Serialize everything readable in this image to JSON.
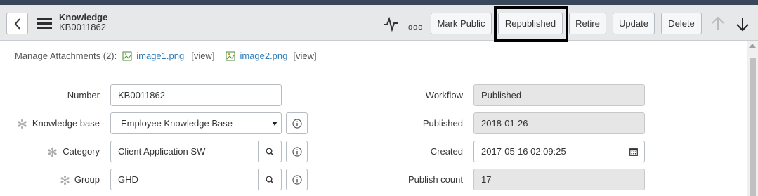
{
  "header": {
    "title": "Knowledge",
    "subtitle": "KB0011862",
    "buttons": {
      "mark_public": "Mark Public",
      "republished": "Republished",
      "retire": "Retire",
      "update": "Update",
      "delete": "Delete"
    },
    "more": "ooo"
  },
  "attachments": {
    "label": "Manage Attachments (2):",
    "files": [
      {
        "name": "image1.png",
        "view": "[view]"
      },
      {
        "name": "image2.png",
        "view": "[view]"
      }
    ]
  },
  "form": {
    "left": [
      {
        "label": "Number",
        "value": "KB0011862",
        "mandatory": false
      },
      {
        "label": "Knowledge base",
        "value": "Employee Knowledge Base",
        "mandatory": true
      },
      {
        "label": "Category",
        "value": "Client Application SW",
        "mandatory": true
      },
      {
        "label": "Group",
        "value": "GHD",
        "mandatory": true
      }
    ],
    "right": [
      {
        "label": "Workflow",
        "value": "Published"
      },
      {
        "label": "Published",
        "value": "2018-01-26"
      },
      {
        "label": "Created",
        "value": "2017-05-16 02:09:25"
      },
      {
        "label": "Publish count",
        "value": "17"
      }
    ],
    "mandatory_marker": "✻"
  },
  "colors": {
    "link": "#2a7ab8",
    "header_bg": "#e6e8ea",
    "readonly_bg": "#e6e6e6"
  }
}
